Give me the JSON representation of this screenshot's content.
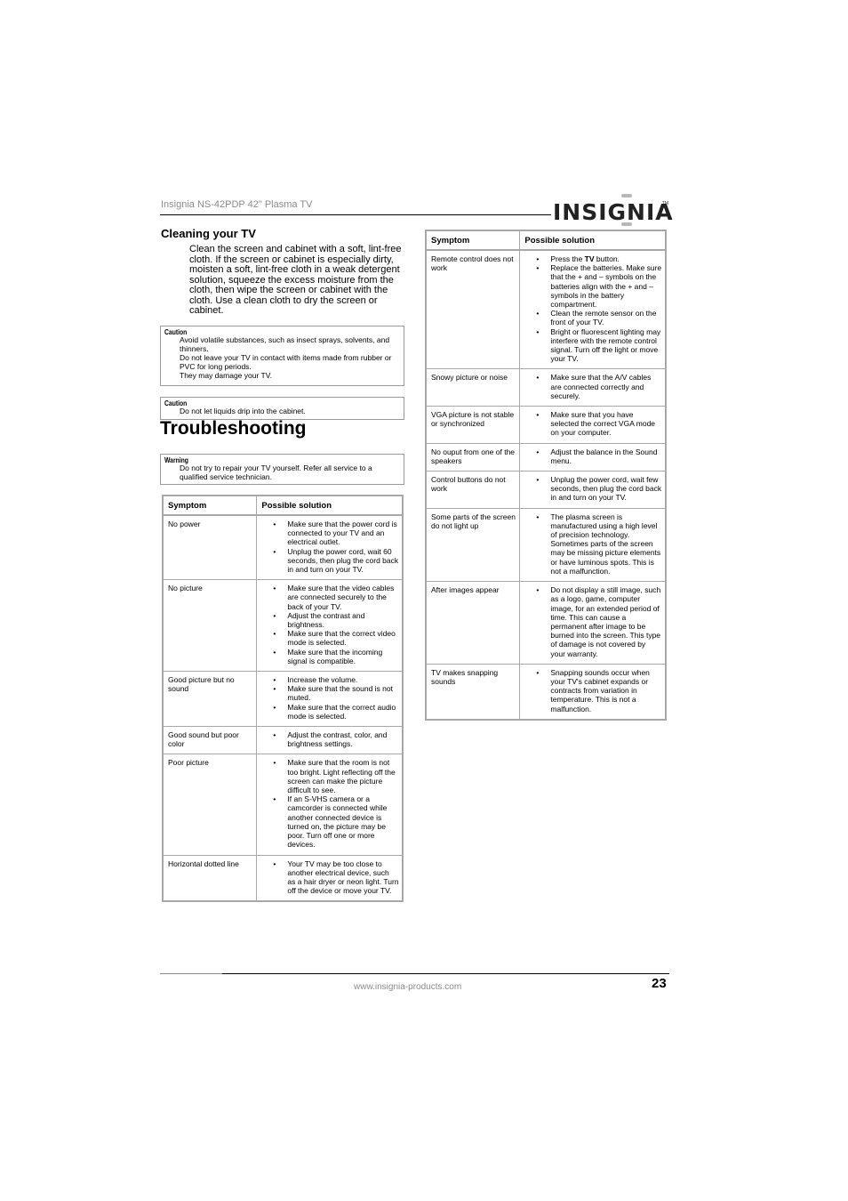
{
  "header": {
    "title": "Insignia NS-42PDP 42\" Plasma TV",
    "logo_text": "INSIGNIA",
    "logo_tm": "TM"
  },
  "cleaning": {
    "heading": "Cleaning your TV",
    "paragraph": "Clean the screen and cabinet with a soft, lint-free cloth. If the screen or cabinet is especially dirty, moisten a soft, lint-free cloth in a weak detergent solution, squeeze the excess moisture from the cloth, then wipe the screen or cabinet with the cloth. Use a clean cloth to dry the screen or cabinet."
  },
  "notes": [
    {
      "label": "Caution",
      "lines": [
        "Avoid volatile substances, such as insect sprays, solvents, and thinners.",
        "Do not leave your TV in contact with items made from rubber or PVC for long periods.",
        "They may damage your TV."
      ]
    },
    {
      "label": "Caution",
      "lines": [
        "Do not let liquids drip into the cabinet."
      ]
    },
    {
      "label": "Warning",
      "lines": [
        "Do not try to repair your TV yourself. Refer all service to a qualified service technician."
      ]
    }
  ],
  "troubleshooting": {
    "heading": "Troubleshooting",
    "columns": [
      "Symptom",
      "Possible solution"
    ],
    "left_rows": [
      {
        "symptom": "No power",
        "solutions": [
          "Make sure that the power cord is connected to your TV and an electrical outlet.",
          "Unplug the power cord, wait 60 seconds, then plug the cord back in and turn on your TV."
        ]
      },
      {
        "symptom": "No picture",
        "solutions": [
          "Make sure that the video cables are connected securely to the back of your TV.",
          "Adjust the contrast and brightness.",
          "Make sure that the correct video mode is selected.",
          "Make sure that the incoming signal is compatible."
        ]
      },
      {
        "symptom": "Good picture but no sound",
        "solutions": [
          "Increase the volume.",
          "Make sure that the sound is not muted.",
          "Make sure that the correct audio mode is selected."
        ]
      },
      {
        "symptom": "Good sound but poor color",
        "solutions": [
          "Adjust the contrast, color, and brightness settings."
        ]
      },
      {
        "symptom": "Poor picture",
        "solutions": [
          "Make sure that the room is not too bright. Light reflecting off the screen can make the picture difficult to see.",
          "If an S-VHS camera or a camcorder is connected while another connected device is turned on, the picture may be poor. Turn off one or more devices."
        ]
      },
      {
        "symptom": "Horizontal dotted line",
        "solutions": [
          "Your TV may be too close to another electrical device, such as a hair dryer or neon light. Turn off the device or move your TV."
        ]
      }
    ],
    "right_rows": [
      {
        "symptom": "Remote control does not work",
        "solutions": [
          "Press the TV button.",
          "Replace the batteries. Make sure that the + and – symbols on the batteries align with the + and – symbols in the battery compartment.",
          "Clean the remote sensor on the front of your TV.",
          "Bright or fluorescent lighting may interfere with the remote control signal. Turn off the light or move your TV."
        ]
      },
      {
        "symptom": "Snowy picture or noise",
        "solutions": [
          "Make sure that the A/V cables are connected correctly and securely."
        ]
      },
      {
        "symptom": "VGA picture is not stable or synchronized",
        "solutions": [
          "Make sure that you have selected the correct VGA mode on your computer."
        ]
      },
      {
        "symptom": "No ouput from one of the speakers",
        "solutions": [
          "Adjust the balance in the Sound menu."
        ]
      },
      {
        "symptom": "Control buttons do not work",
        "solutions": [
          "Unplug the power cord, wait few seconds, then plug the cord back in and turn on your TV."
        ]
      },
      {
        "symptom": "Some parts of the screen do not light up",
        "solutions": [
          "The plasma screen is manufactured using a high level of precision technology. Sometimes parts of the screen may be missing picture elements or have luminous spots. This is not a malfunction."
        ]
      },
      {
        "symptom": "After images appear",
        "solutions": [
          "Do not display a still image, such as a logo, game, computer image, for an extended period of time. This can cause a permanent after image to be burned into the screen. This type of damage is not covered by your warranty."
        ]
      },
      {
        "symptom": "TV makes snapping sounds",
        "solutions": [
          "Snapping sounds occur when your TV's cabinet expands or contracts from variation in temperature. This is not a malfunction."
        ]
      }
    ]
  },
  "footer": {
    "url": "www.insignia-products.com",
    "page_number": "23"
  }
}
